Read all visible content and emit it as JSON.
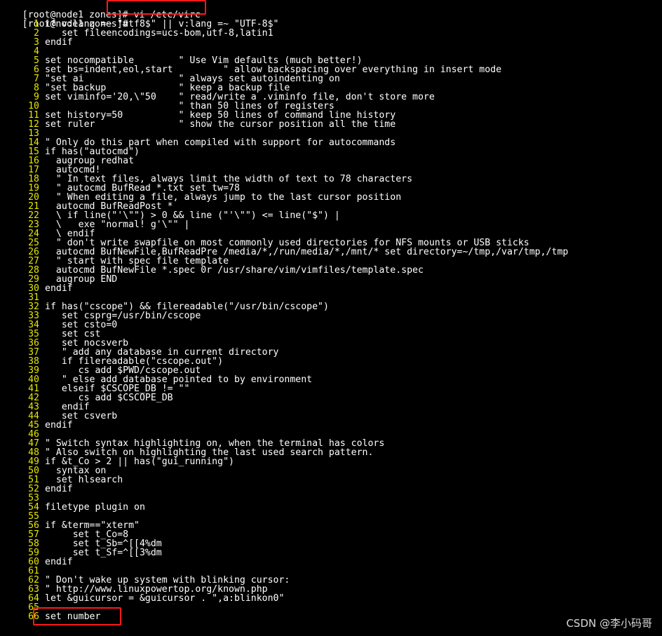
{
  "terminal": {
    "prompt1": "[root@node1 zones]#",
    "command1": " vi /etc/virc",
    "prompt2": "[root@node1 zones]#"
  },
  "vim_lines": [
    {
      "n": "1",
      "t": "if v:lang =~ \"utf8$\" || v:lang =~ \"UTF-8$\""
    },
    {
      "n": "2",
      "t": "   set fileencodings=ucs-bom,utf-8,latin1"
    },
    {
      "n": "3",
      "t": "endif"
    },
    {
      "n": "4",
      "t": ""
    },
    {
      "n": "5",
      "t": "set nocompatible        \" Use Vim defaults (much better!)"
    },
    {
      "n": "6",
      "t": "set bs=indent,eol,start         \" allow backspacing over everything in insert mode"
    },
    {
      "n": "7",
      "t": "\"set ai                 \" always set autoindenting on"
    },
    {
      "n": "8",
      "t": "\"set backup             \" keep a backup file"
    },
    {
      "n": "9",
      "t": "set viminfo='20,\\\"50    \" read/write a .viminfo file, don't store more"
    },
    {
      "n": "10",
      "t": "                        \" than 50 lines of registers"
    },
    {
      "n": "11",
      "t": "set history=50          \" keep 50 lines of command line history"
    },
    {
      "n": "12",
      "t": "set ruler               \" show the cursor position all the time"
    },
    {
      "n": "13",
      "t": ""
    },
    {
      "n": "14",
      "t": "\" Only do this part when compiled with support for autocommands"
    },
    {
      "n": "15",
      "t": "if has(\"autocmd\")"
    },
    {
      "n": "16",
      "t": "  augroup redhat"
    },
    {
      "n": "17",
      "t": "  autocmd!"
    },
    {
      "n": "18",
      "t": "  \" In text files, always limit the width of text to 78 characters"
    },
    {
      "n": "19",
      "t": "  \" autocmd BufRead *.txt set tw=78"
    },
    {
      "n": "20",
      "t": "  \" When editing a file, always jump to the last cursor position"
    },
    {
      "n": "21",
      "t": "  autocmd BufReadPost *"
    },
    {
      "n": "22",
      "t": "  \\ if line(\"'\\\"\") > 0 && line (\"'\\\"\") <= line(\"$\") |"
    },
    {
      "n": "23",
      "t": "  \\   exe \"normal! g'\\\"\" |"
    },
    {
      "n": "24",
      "t": "  \\ endif"
    },
    {
      "n": "25",
      "t": "  \" don't write swapfile on most commonly used directories for NFS mounts or USB sticks"
    },
    {
      "n": "26",
      "t": "  autocmd BufNewFile,BufReadPre /media/*,/run/media/*,/mnt/* set directory=~/tmp,/var/tmp,/tmp"
    },
    {
      "n": "27",
      "t": "  \" start with spec file template"
    },
    {
      "n": "28",
      "t": "  autocmd BufNewFile *.spec 0r /usr/share/vim/vimfiles/template.spec"
    },
    {
      "n": "29",
      "t": "  augroup END"
    },
    {
      "n": "30",
      "t": "endif"
    },
    {
      "n": "31",
      "t": ""
    },
    {
      "n": "32",
      "t": "if has(\"cscope\") && filereadable(\"/usr/bin/cscope\")"
    },
    {
      "n": "33",
      "t": "   set csprg=/usr/bin/cscope"
    },
    {
      "n": "34",
      "t": "   set csto=0"
    },
    {
      "n": "35",
      "t": "   set cst"
    },
    {
      "n": "36",
      "t": "   set nocsverb"
    },
    {
      "n": "37",
      "t": "   \" add any database in current directory"
    },
    {
      "n": "38",
      "t": "   if filereadable(\"cscope.out\")"
    },
    {
      "n": "39",
      "t": "      cs add $PWD/cscope.out"
    },
    {
      "n": "40",
      "t": "   \" else add database pointed to by environment"
    },
    {
      "n": "41",
      "t": "   elseif $CSCOPE_DB != \"\""
    },
    {
      "n": "42",
      "t": "      cs add $CSCOPE_DB"
    },
    {
      "n": "43",
      "t": "   endif"
    },
    {
      "n": "44",
      "t": "   set csverb"
    },
    {
      "n": "45",
      "t": "endif"
    },
    {
      "n": "46",
      "t": ""
    },
    {
      "n": "47",
      "t": "\" Switch syntax highlighting on, when the terminal has colors"
    },
    {
      "n": "48",
      "t": "\" Also switch on highlighting the last used search pattern."
    },
    {
      "n": "49",
      "t": "if &t_Co > 2 || has(\"gui_running\")"
    },
    {
      "n": "50",
      "t": "  syntax on"
    },
    {
      "n": "51",
      "t": "  set hlsearch"
    },
    {
      "n": "52",
      "t": "endif"
    },
    {
      "n": "53",
      "t": ""
    },
    {
      "n": "54",
      "t": "filetype plugin on"
    },
    {
      "n": "55",
      "t": ""
    },
    {
      "n": "56",
      "t": "if &term==\"xterm\""
    },
    {
      "n": "57",
      "t": "     set t_Co=8"
    },
    {
      "n": "58",
      "t": "     set t_Sb=^[[4%dm"
    },
    {
      "n": "59",
      "t": "     set t_Sf=^[[3%dm"
    },
    {
      "n": "60",
      "t": "endif"
    },
    {
      "n": "61",
      "t": ""
    },
    {
      "n": "62",
      "t": "\" Don't wake up system with blinking cursor:"
    },
    {
      "n": "63",
      "t": "\" http://www.linuxpowertop.org/known.php"
    },
    {
      "n": "64",
      "t": "let &guicursor = &guicursor . \",a:blinkon0\""
    },
    {
      "n": "65",
      "t": ""
    },
    {
      "n": "66",
      "t": "set number"
    }
  ],
  "watermark": "CSDN @李小码哥",
  "colors": {
    "background": "#000000",
    "text": "#ffffff",
    "line_number": "#e6e600",
    "annotation": "#ff1a1a"
  }
}
